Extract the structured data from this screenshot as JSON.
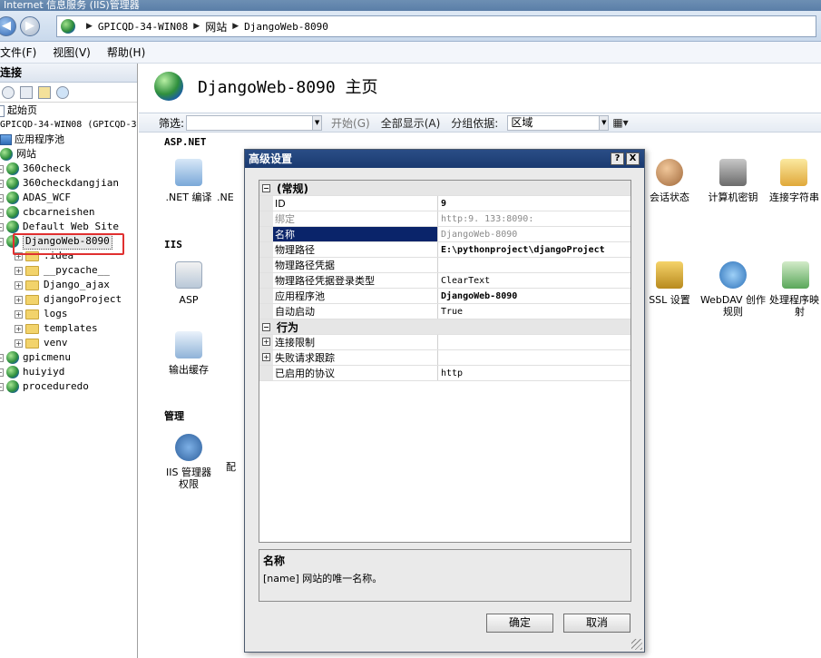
{
  "window": {
    "title": "Internet 信息服务 (IIS)管理器"
  },
  "address": {
    "crumbs": [
      "GPICQD-34-WIN08",
      "网站",
      "DjangoWeb-8090"
    ]
  },
  "menu": {
    "file": "文件(F)",
    "view": "视图(V)",
    "help": "帮助(H)"
  },
  "connections": {
    "header": "连接",
    "start_page": "起始页",
    "server": "GPICQD-34-WIN08 (GPICQD-34",
    "app_pools": "应用程序池",
    "sites": "网站",
    "site_items": [
      "360check",
      "360checkdangjian",
      "ADAS_WCF",
      "cbcarneishen",
      "Default Web Site",
      "DjangoWeb-8090"
    ],
    "django_children": [
      ".idea",
      "__pycache__",
      "Django_ajax",
      "djangoProject",
      "logs",
      "templates",
      "venv"
    ],
    "more_sites": [
      "gpicmenu",
      "huiyiyd",
      "proceduredo"
    ]
  },
  "main": {
    "title": "DjangoWeb-8090 主页",
    "filter_label": "筛选:",
    "start_label": "开始(G)",
    "show_all_label": "全部显示(A)",
    "group_label": "分组依据:",
    "group_value": "区域",
    "sections": {
      "aspnet": "ASP.NET",
      "iis": "IIS",
      "manage": "管理"
    },
    "features": {
      "net_compile": ".NET 编译",
      "net_cut": ".NE",
      "session_state": "会话状态",
      "machine_key": "计算机密钥",
      "conn_string": "连接字符串",
      "asp": "ASP",
      "output_cache": "输出缓存",
      "ssl": "SSL 设置",
      "webdav_1": "WebDAV 创作",
      "webdav_2": "规则",
      "handler_1": "处理程序映",
      "handler_2": "射",
      "iis_mgr_1": "IIS 管理器",
      "iis_mgr_2": "权限",
      "config_cut": "配"
    }
  },
  "dialog": {
    "title": "高级设置",
    "help_btn": "?",
    "close_btn": "X",
    "categories": {
      "general": "(常规)",
      "behavior": "行为"
    },
    "props": [
      {
        "name": "ID",
        "value": "9"
      },
      {
        "name": "绑定",
        "value": "http:9.          133:8090:"
      },
      {
        "name": "名称",
        "value": "DjangoWeb-8090"
      },
      {
        "name": "物理路径",
        "value": "E:\\pythonproject\\djangoProject"
      },
      {
        "name": "物理路径凭据",
        "value": ""
      },
      {
        "name": "物理路径凭据登录类型",
        "value": "ClearText"
      },
      {
        "name": "应用程序池",
        "value": "DjangoWeb-8090"
      },
      {
        "name": "自动启动",
        "value": "True"
      }
    ],
    "behavior_props": [
      {
        "name": "连接限制",
        "value": ""
      },
      {
        "name": "失败请求跟踪",
        "value": ""
      },
      {
        "name": "已启用的协议",
        "value": "http"
      }
    ],
    "desc_title": "名称",
    "desc_text": "[name] 网站的唯一名称。",
    "ok": "确定",
    "cancel": "取消"
  }
}
